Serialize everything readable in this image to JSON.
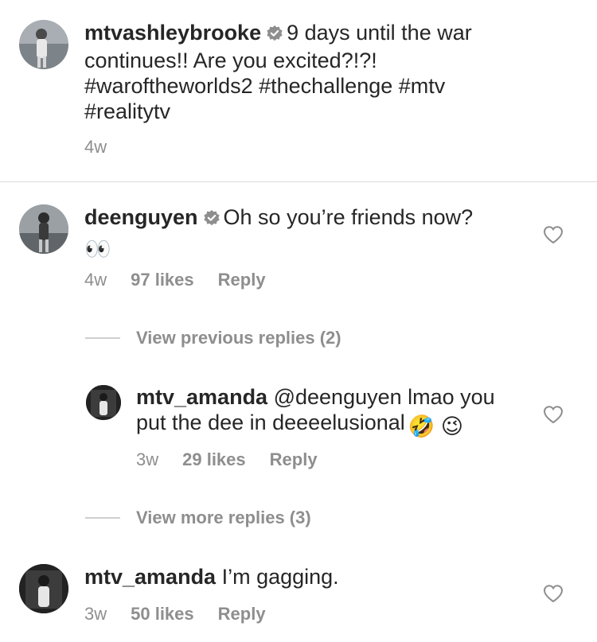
{
  "caption": {
    "username": "mtvashleybrooke",
    "text": "9 days until the war continues!! Are you excited?!?! #waroftheworlds2 #thechallenge #mtv #realitytv",
    "time": "4w"
  },
  "comments": [
    {
      "username": "deenguyen",
      "text": "Oh so you’re friends now?",
      "emoji": "👀",
      "time": "4w",
      "likes": "97 likes",
      "reply": "Reply",
      "view_previous": "View previous replies (2)",
      "replies": [
        {
          "username": "mtv_amanda",
          "text": "@deenguyen lmao you put the dee in deeeelusional",
          "emoji": "🤣 😉",
          "time": "3w",
          "likes": "29 likes",
          "reply": "Reply"
        }
      ],
      "view_more": "View more replies (3)"
    },
    {
      "username": "mtv_amanda",
      "text": "I’m gagging.",
      "time": "3w",
      "likes": "50 likes",
      "reply": "Reply"
    }
  ],
  "icons": {
    "verified": "verified-badge-icon",
    "like": "heart-outline-icon"
  },
  "colors": {
    "text": "#262626",
    "secondary": "#8e8e8e",
    "divider": "#dbdbdb"
  }
}
